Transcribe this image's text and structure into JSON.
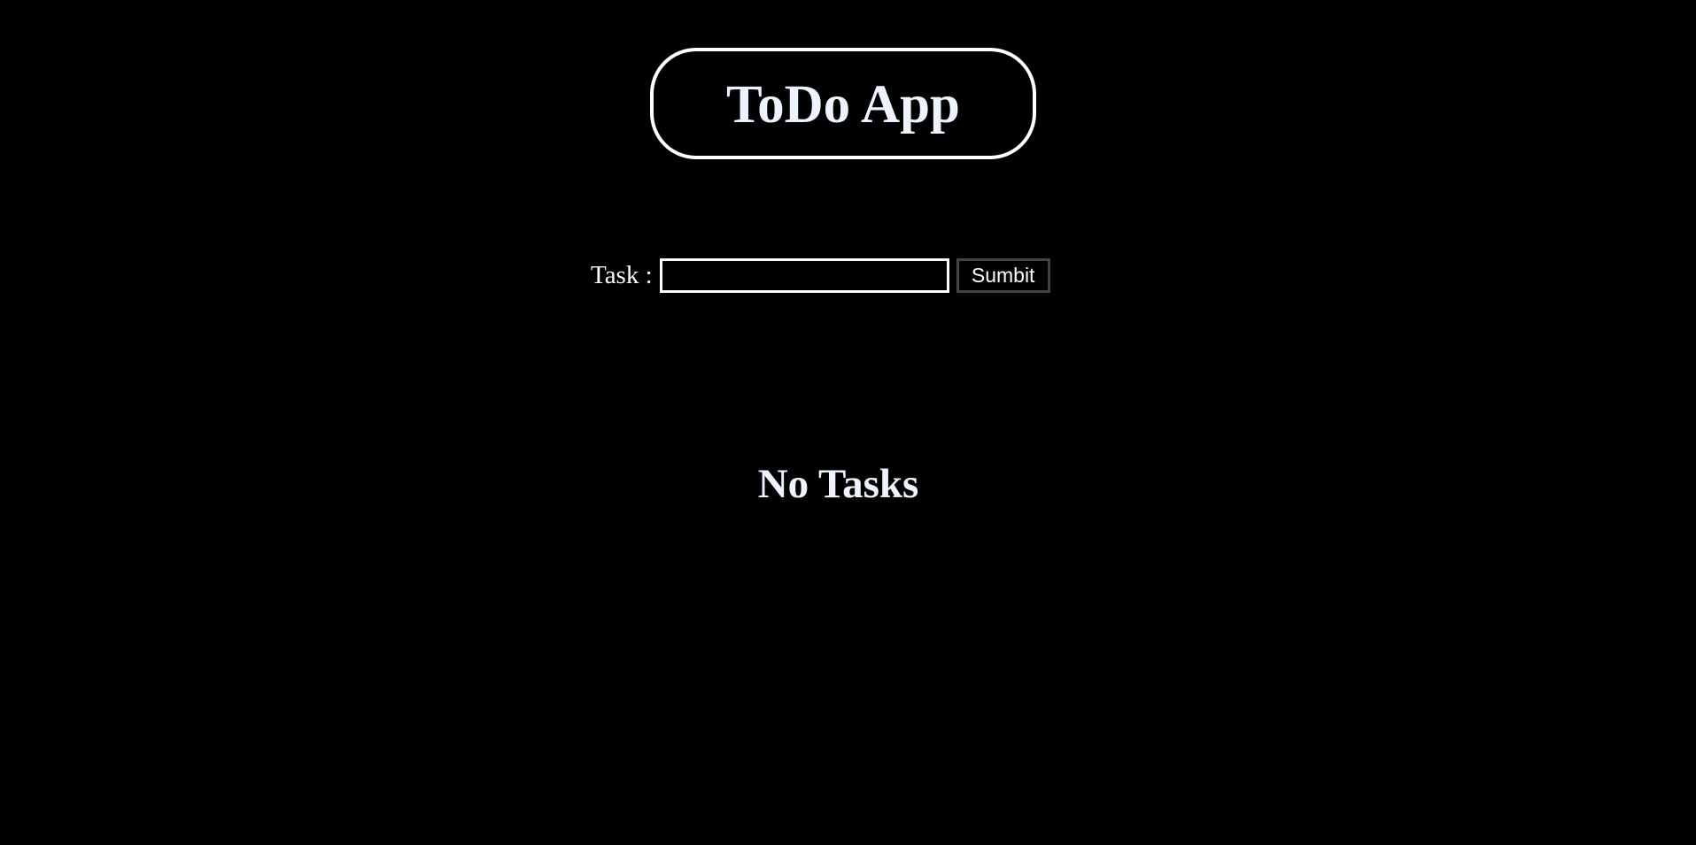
{
  "app": {
    "title": "ToDo App"
  },
  "form": {
    "task_label": "Task :",
    "task_value": "",
    "task_placeholder": "",
    "submit_label": "Sumbit"
  },
  "tasks": {
    "empty_message": "No Tasks",
    "items": []
  },
  "colors": {
    "background": "#000000",
    "foreground": "#ffffff",
    "title_text": "#eef4ff",
    "button_border": "#444444"
  }
}
